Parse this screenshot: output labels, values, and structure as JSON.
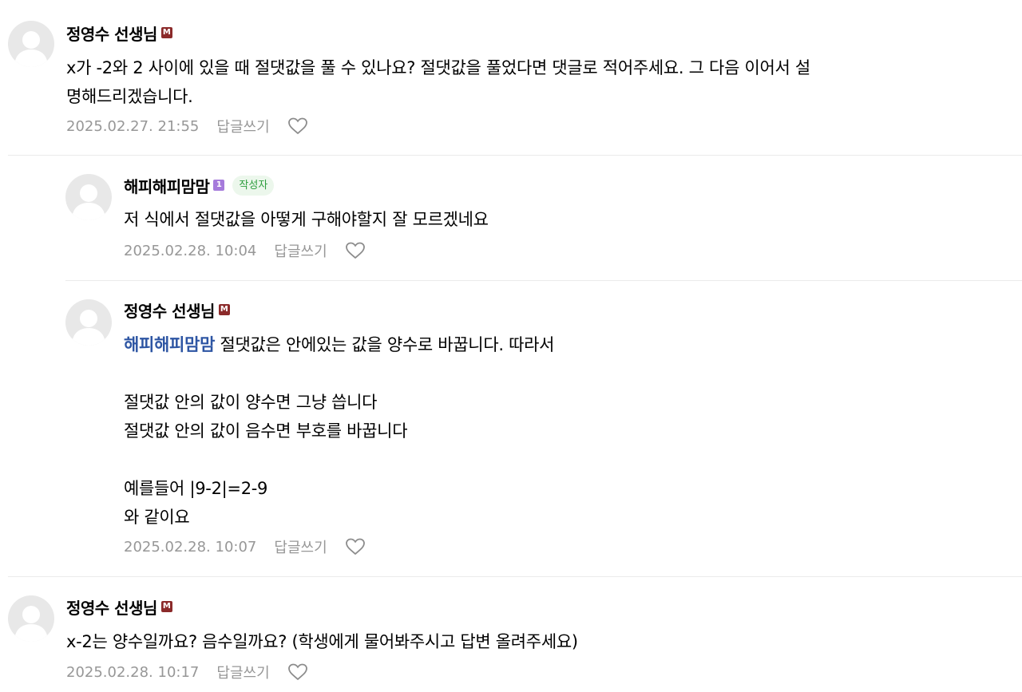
{
  "comments": [
    {
      "author": "정영수 선생님",
      "badge": "M",
      "text": "x가 -2와 2 사이에 있을 때 절댓값을 풀 수 있나요? 절댓값을 풀었다면 댓글로 적어주세요. 그 다음 이어서 설\n명해드리겠습니다.",
      "date": "2025.02.27. 21:55",
      "reply_label": "답글쓰기"
    },
    {
      "author": "해피해피맘맘",
      "badge": "1",
      "writer_tag": "작성자",
      "text": "저 식에서 절댓값을 아떻게 구해야할지 잘 모르겠네요",
      "date": "2025.02.28. 10:04",
      "reply_label": "답글쓰기"
    },
    {
      "author": "정영수 선생님",
      "badge": "M",
      "mention": "해피해피맘맘",
      "text": " 절댓값은 안에있는 값을 양수로 바꿉니다. 따라서\n\n절댓값 안의 값이 양수면 그냥 씁니다\n절댓값 안의 값이 음수면 부호를 바꿉니다\n\n예를들어 |9-2|=2-9\n와 같이요",
      "date": "2025.02.28. 10:07",
      "reply_label": "답글쓰기"
    },
    {
      "author": "정영수 선생님",
      "badge": "M",
      "text": "x-2는 양수일까요? 음수일까요? (학생에게 물어봐주시고 답변 올려주세요)",
      "date": "2025.02.28. 10:17",
      "reply_label": "답글쓰기"
    }
  ],
  "icons": {
    "avatar": "default-profile-icon",
    "like": "heart-outline-icon"
  },
  "colors": {
    "mention": "#2d55a3",
    "badge_manager": "#8b2a2a",
    "badge_level": "#a57adb",
    "writer_tag_text": "#2f9e3f",
    "meta": "#979797"
  }
}
